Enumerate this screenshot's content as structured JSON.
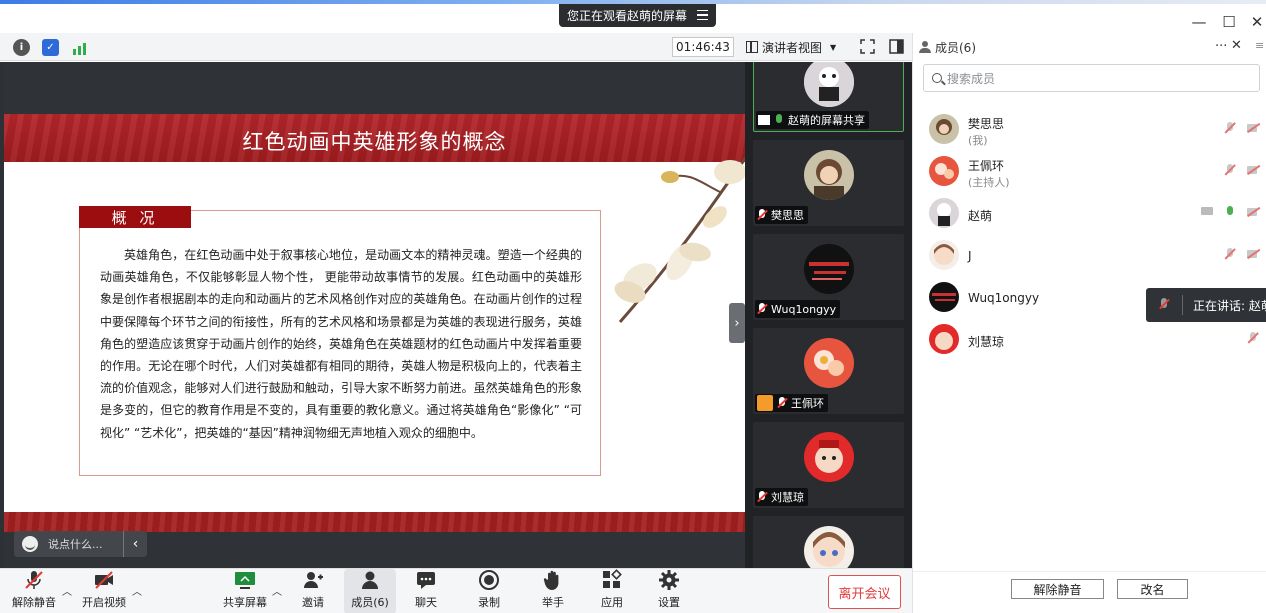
{
  "share_banner": {
    "text": "您正在观看赵萌的屏幕"
  },
  "toolbar": {
    "time": "01:46:43",
    "view_label": "演讲者视图"
  },
  "slide": {
    "title": "红色动画中英雄形象的概念",
    "section_tag": "概 况",
    "body": "英雄角色，在红色动画中处于叙事核心地位，是动画文本的精神灵魂。塑造一个经典的动画英雄角色，不仅能够彰显人物个性， 更能带动故事情节的发展。红色动画中的英雄形象是创作者根据剧本的走向和动画片的艺术风格创作对应的英雄角色。在动画片创作的过程中要保障每个环节之间的衔接性，所有的艺术风格和场景都是为英雄的表现进行服务，英雄角色的塑造应该贯穿于动画片创作的始终，英雄角色在英雄题材的红色动画片中发挥着重要的作用。无论在哪个时代，人们对英雄都有相同的期待，英雄人物是积极向上的，代表着主流的价值观念，能够对人们进行鼓励和触动，引导大家不断努力前进。虽然英雄角色的形象是多变的，但它的教育作用是不变的，具有重要的教化意义。通过将英雄角色“影像化” “可视化” “艺术化”，把英雄的“基因”精神润物细无声地植入观众的细胞中。"
  },
  "comment": {
    "placeholder": "说点什么..."
  },
  "videos": [
    {
      "label": "赵萌的屏幕共享"
    },
    {
      "label": "樊思思"
    },
    {
      "label": "Wuq1ongyy"
    },
    {
      "label": "王佩环"
    },
    {
      "label": "刘慧琼"
    }
  ],
  "panel": {
    "title": "成员(6)",
    "search_placeholder": "搜索成员",
    "members": [
      {
        "name": "樊思思",
        "sub": "(我)"
      },
      {
        "name": "王佩环",
        "sub": "(主持人)"
      },
      {
        "name": "赵萌",
        "sub": ""
      },
      {
        "name": "J",
        "sub": ""
      },
      {
        "name": "Wuq1ongyy",
        "sub": ""
      },
      {
        "name": "刘慧琼",
        "sub": ""
      }
    ],
    "speaking": "正在讲话: 赵萌",
    "unmute_all": "解除静音",
    "rename": "改名"
  },
  "bottombar": {
    "unmute": "解除静音",
    "video": "开启视频",
    "share": "共享屏幕",
    "invite": "邀请",
    "members": "成员(6)",
    "chat": "聊天",
    "record": "录制",
    "raise": "举手",
    "apps": "应用",
    "settings": "设置",
    "leave": "离开会议"
  }
}
